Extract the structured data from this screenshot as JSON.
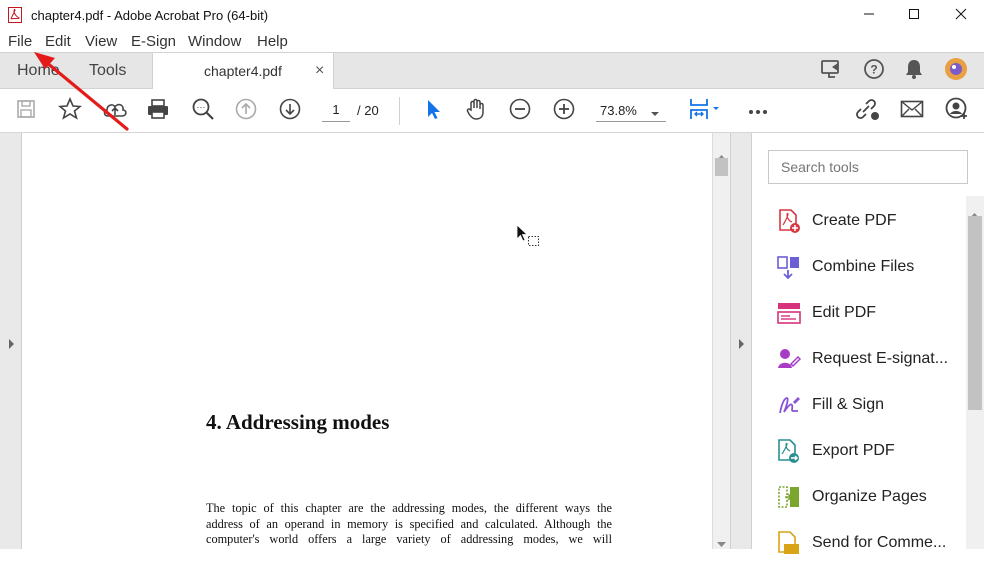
{
  "window": {
    "title": "chapter4.pdf - Adobe Acrobat Pro (64-bit)",
    "controls": [
      "minimize-icon",
      "maximize-icon",
      "close-icon"
    ]
  },
  "menubar": {
    "items": [
      "File",
      "Edit",
      "View",
      "E-Sign",
      "Window",
      "Help"
    ]
  },
  "tabs": {
    "home": "Home",
    "tools": "Tools",
    "document": "chapter4.pdf",
    "close_glyph": "×"
  },
  "toolbar": {
    "page_current": "1",
    "page_total": "/ 20",
    "zoom": "73.8%",
    "icons": [
      "save-icon",
      "bookmark-star-icon",
      "cloud-upload-icon",
      "print-icon",
      "zoom-search-icon",
      "page-up-icon",
      "page-down-icon",
      "select-cursor-icon",
      "hand-icon",
      "zoom-out-icon",
      "zoom-in-icon",
      "page-layout-icon",
      "more-icon",
      "share-link-icon",
      "email-icon",
      "add-user-icon"
    ]
  },
  "document": {
    "heading": "4. Addressing modes",
    "paragraph_lines": [
      "The topic of this chapter are the addressing modes, the different ways the",
      "address of an operand in memory is specified and calculated. Although the",
      "computer's world offers a large variety of addressing modes, we will"
    ]
  },
  "tools_pane": {
    "search_placeholder": "Search tools",
    "items": [
      {
        "label": "Create PDF",
        "icon": "create-pdf-icon",
        "color": "#d7373f"
      },
      {
        "label": "Combine Files",
        "icon": "combine-files-icon",
        "color": "#6b5fd8"
      },
      {
        "label": "Edit PDF",
        "icon": "edit-pdf-icon",
        "color": "#d6337c"
      },
      {
        "label": "Request E-signat...",
        "icon": "request-esign-icon",
        "color": "#a83cc4"
      },
      {
        "label": "Fill & Sign",
        "icon": "fill-sign-icon",
        "color": "#8a52d6"
      },
      {
        "label": "Export PDF",
        "icon": "export-pdf-icon",
        "color": "#2a8f8f"
      },
      {
        "label": "Organize Pages",
        "icon": "organize-pages-icon",
        "color": "#7aa62e"
      },
      {
        "label": "Send for Comme...",
        "icon": "send-comment-icon",
        "color": "#d8a416"
      }
    ]
  },
  "colors": {
    "accent_blue": "#1473e6",
    "annotation_arrow": "#e41b1b"
  }
}
